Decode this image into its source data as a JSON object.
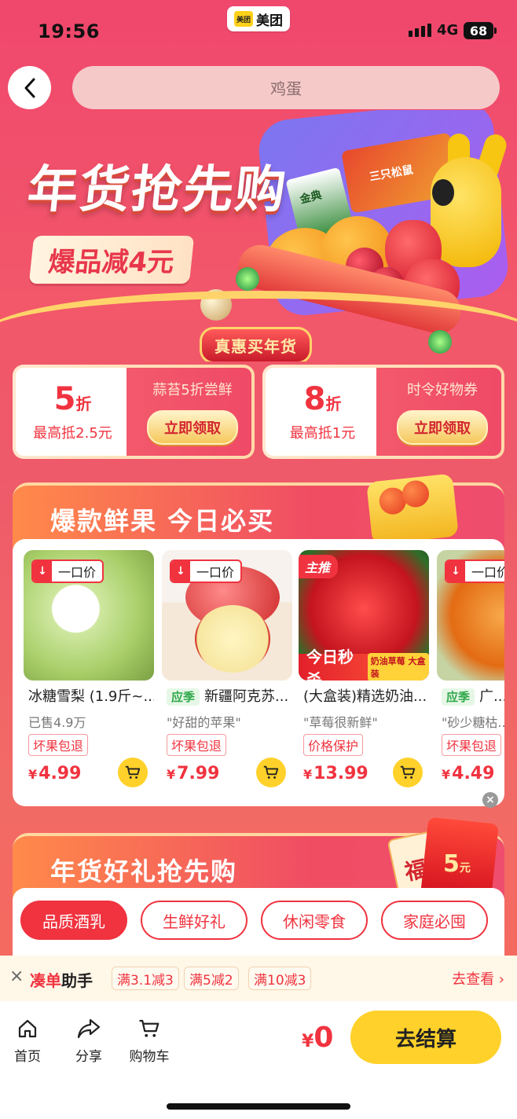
{
  "status_bar": {
    "time": "19:56",
    "app_logo": "美团",
    "app_name": "美团",
    "network": "4G",
    "battery": "68"
  },
  "header": {
    "search_text": "鸡蛋"
  },
  "banner": {
    "title": "年货抢先购",
    "subtitle": "爆品减4元",
    "tag": "真惠买年货",
    "milk_label": "金典",
    "box_label": "三只松鼠"
  },
  "coupons": [
    {
      "rate_num": "5",
      "rate_unit": "折",
      "max": "最高抵2.5元",
      "desc": "蒜苔5折尝鲜",
      "button": "立即领取"
    },
    {
      "rate_num": "8",
      "rate_unit": "折",
      "max": "最高抵1元",
      "desc": "时令好物券",
      "button": "立即领取"
    }
  ],
  "section1": {
    "title": "爆款鲜果  今日必买",
    "products": [
      {
        "img_tag": "一口价",
        "name": "冰糖雪梨 (1.9斤~...",
        "sub": "已售4.9万",
        "badge": "坏果包退",
        "price": "4.99"
      },
      {
        "img_tag": "一口价",
        "season": "应季",
        "name": "新疆阿克苏...",
        "sub": "\"好甜的苹果\"",
        "badge": "坏果包退",
        "price": "7.99"
      },
      {
        "img_tag": "主推",
        "seckill": "今日秒杀",
        "seckill_mini": "奶油草莓 大盒装",
        "name": "(大盒装)精选奶油...",
        "sub": "\"草莓很新鲜\"",
        "badge": "价格保护",
        "price": "13.99"
      },
      {
        "img_tag": "一口价",
        "season": "应季",
        "name": "广...",
        "sub": "\"砂少糖枯...",
        "badge": "坏果包退",
        "price": "4.49"
      }
    ],
    "currency": "¥"
  },
  "section2": {
    "title": "年货好礼抢先购",
    "redpacket_amount": "5",
    "redpacket_unit": "元",
    "fu": "福",
    "tabs": [
      "品质酒乳",
      "生鲜好礼",
      "休闲零食",
      "家庭必囤"
    ]
  },
  "helper": {
    "title_red": "凑单",
    "title_black": "助手",
    "chips": [
      "满3.1减3",
      "满5减2",
      "满10减3"
    ],
    "link": "去查看"
  },
  "bottom_nav": {
    "items": [
      {
        "label": "首页",
        "icon": "home-icon"
      },
      {
        "label": "分享",
        "icon": "share-icon"
      },
      {
        "label": "购物车",
        "icon": "cart-icon"
      }
    ],
    "total_currency": "¥",
    "total": "0",
    "checkout": "去结算"
  },
  "colors": {
    "accent": "#f0333f",
    "yellow": "#ffd12a",
    "banner_pink": "#f0476d"
  }
}
